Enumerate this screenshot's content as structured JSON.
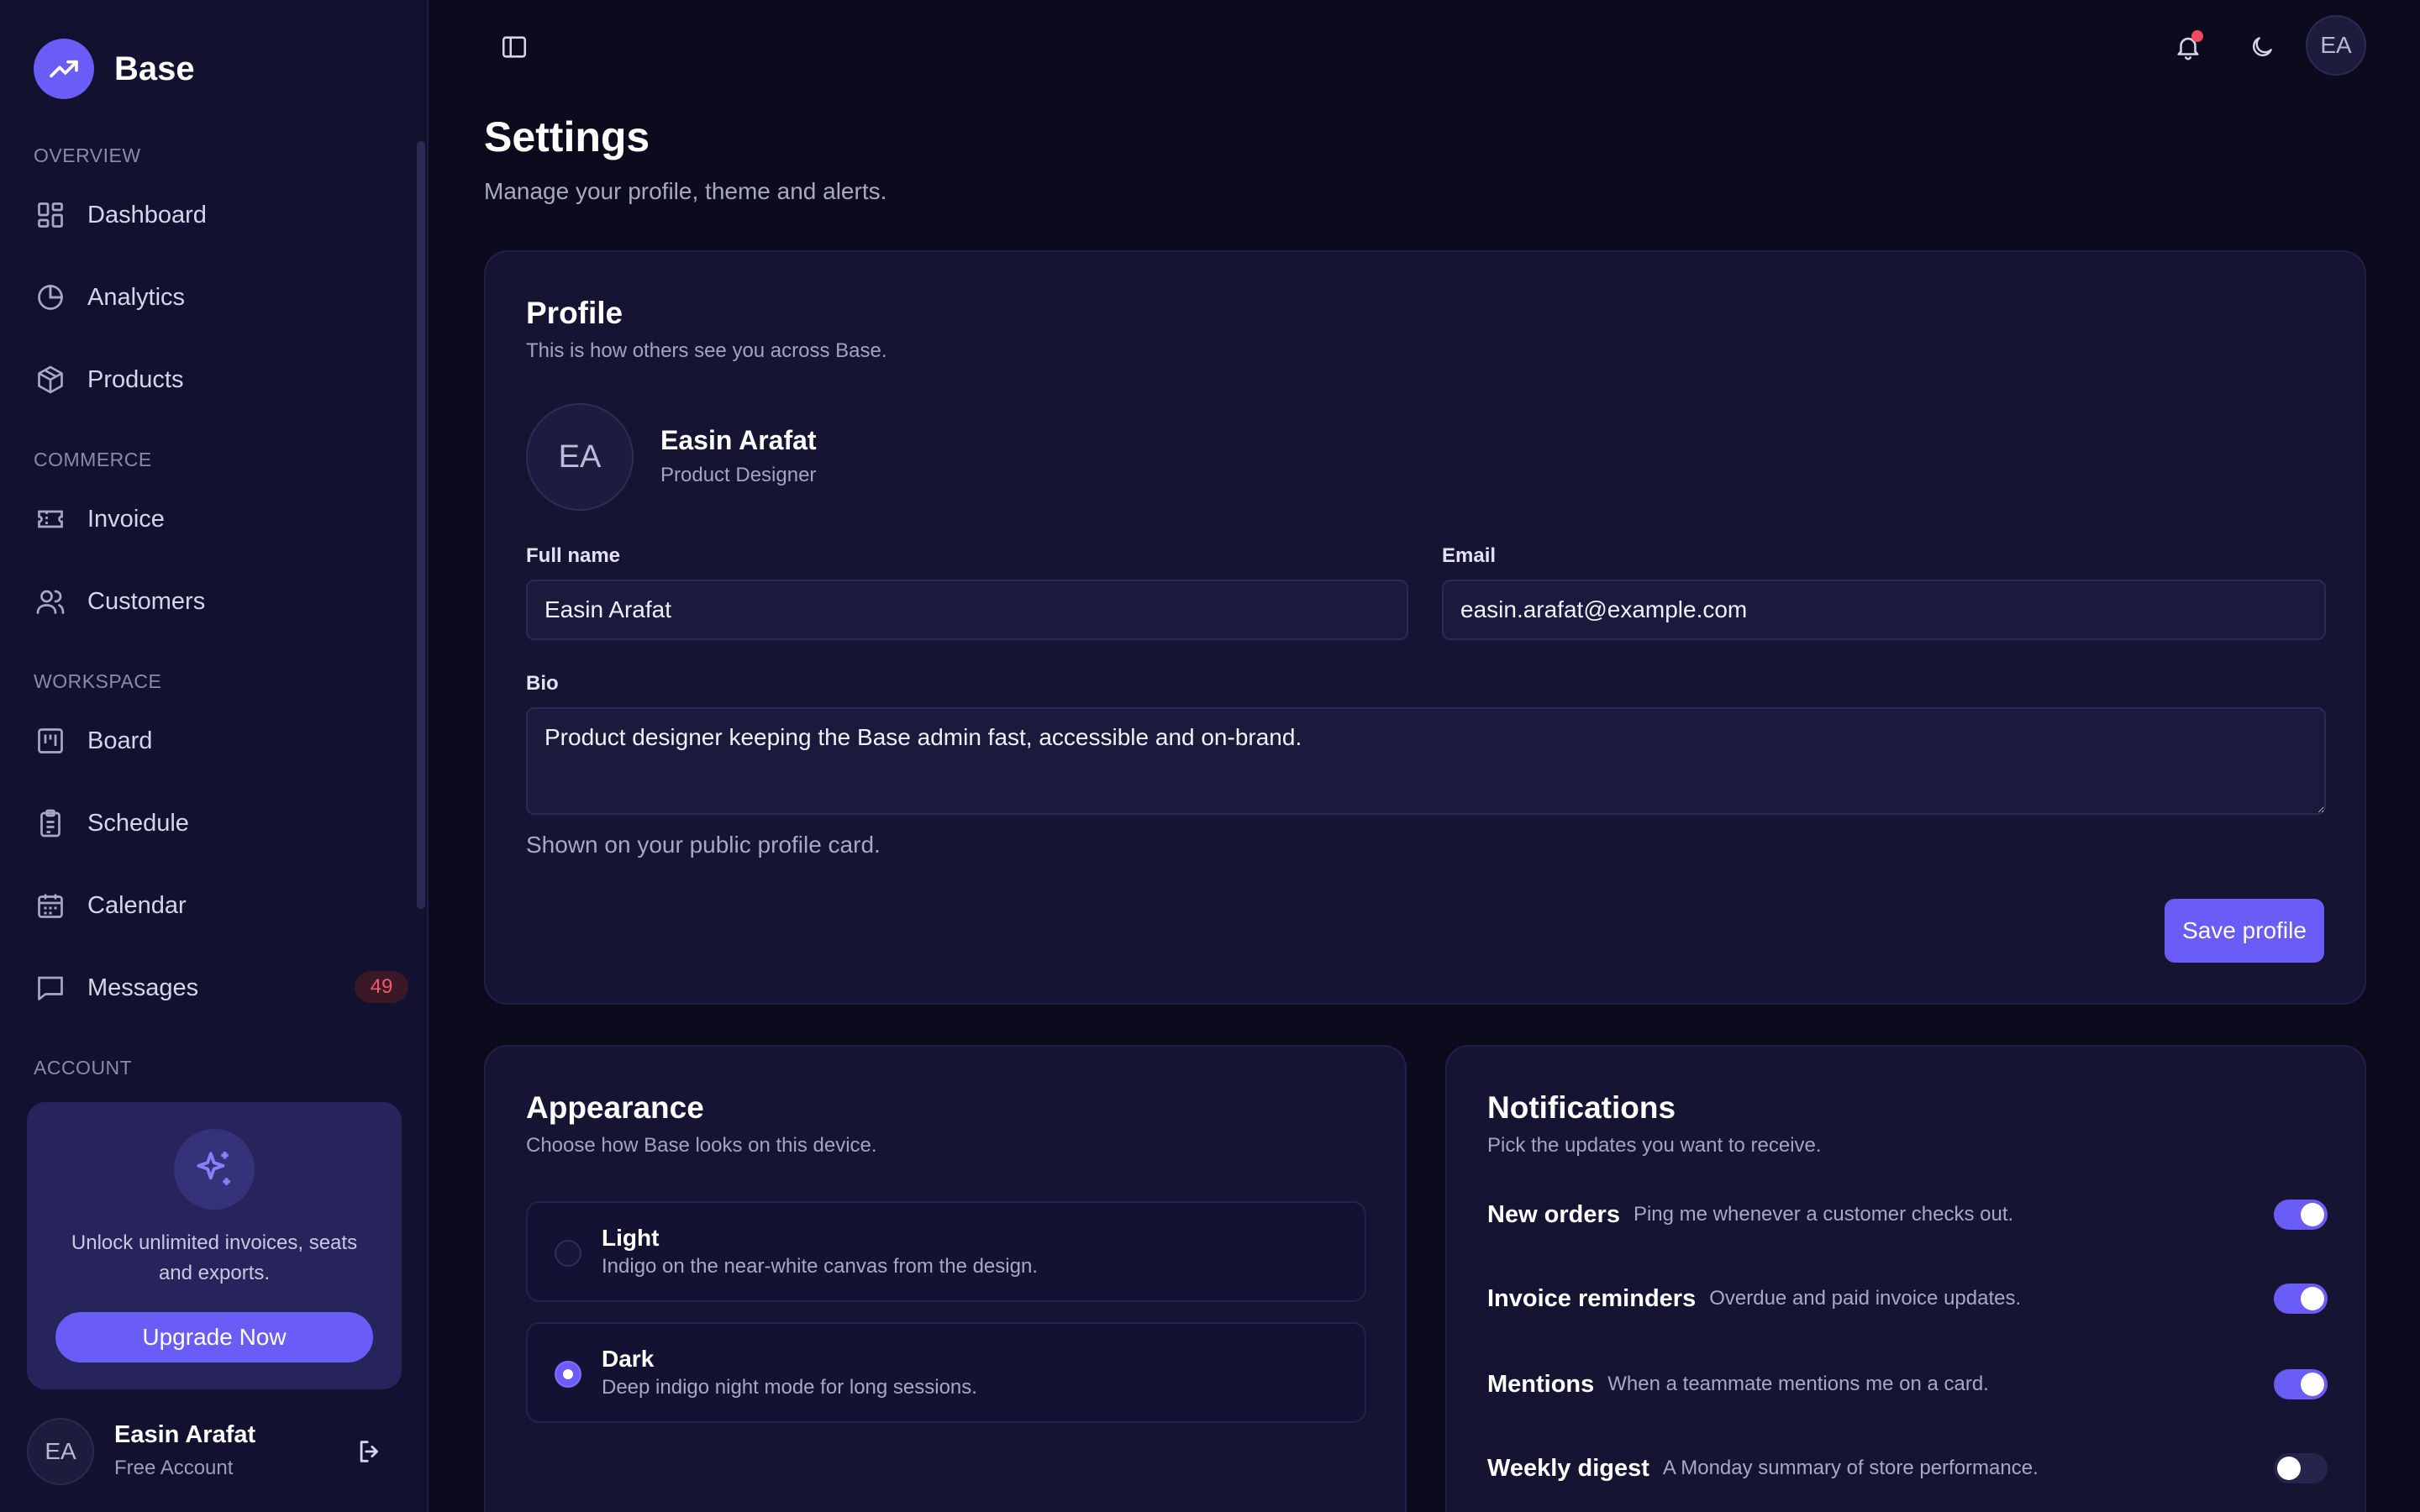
{
  "app": {
    "name": "Base"
  },
  "sidebar": {
    "sections": {
      "overview": "OVERVIEW",
      "commerce": "COMMERCE",
      "workspace": "WORKSPACE",
      "account": "ACCOUNT"
    },
    "items": [
      {
        "label": "Dashboard",
        "icon": "dashboard-icon"
      },
      {
        "label": "Analytics",
        "icon": "pie-chart-icon"
      },
      {
        "label": "Products",
        "icon": "box-icon"
      },
      {
        "label": "Invoice",
        "icon": "ticket-icon"
      },
      {
        "label": "Customers",
        "icon": "users-icon"
      },
      {
        "label": "Board",
        "icon": "kanban-icon"
      },
      {
        "label": "Schedule",
        "icon": "clipboard-icon"
      },
      {
        "label": "Calendar",
        "icon": "calendar-icon"
      },
      {
        "label": "Messages",
        "icon": "message-icon",
        "badge": "49"
      }
    ],
    "promo": {
      "text": "Unlock unlimited invoices, seats and exports.",
      "button": "Upgrade Now"
    },
    "user": {
      "initials": "EA",
      "name": "Easin Arafat",
      "plan": "Free Account"
    }
  },
  "topbar": {
    "avatar_initials": "EA"
  },
  "page": {
    "title": "Settings",
    "subtitle": "Manage your profile, theme and alerts."
  },
  "profile": {
    "title": "Profile",
    "subtitle": "This is how others see you across Base.",
    "initials": "EA",
    "name": "Easin Arafat",
    "role": "Product Designer",
    "full_name_label": "Full name",
    "full_name_value": "Easin Arafat",
    "email_label": "Email",
    "email_value": "easin.arafat@example.com",
    "bio_label": "Bio",
    "bio_value": "Product designer keeping the Base admin fast, accessible and on-brand.",
    "bio_hint": "Shown on your public profile card.",
    "save_label": "Save profile"
  },
  "appearance": {
    "title": "Appearance",
    "subtitle": "Choose how Base looks on this device.",
    "options": [
      {
        "title": "Light",
        "desc": "Indigo on the near-white canvas from the design.",
        "selected": false
      },
      {
        "title": "Dark",
        "desc": "Deep indigo night mode for long sessions.",
        "selected": true
      }
    ]
  },
  "notifications": {
    "title": "Notifications",
    "subtitle": "Pick the updates you want to receive.",
    "items": [
      {
        "title": "New orders",
        "desc": "Ping me whenever a customer checks out.",
        "enabled": true
      },
      {
        "title": "Invoice reminders",
        "desc": "Overdue and paid invoice updates.",
        "enabled": true
      },
      {
        "title": "Mentions",
        "desc": "When a teammate mentions me on a card.",
        "enabled": true
      },
      {
        "title": "Weekly digest",
        "desc": "A Monday summary of store performance.",
        "enabled": false
      }
    ]
  },
  "colors": {
    "accent": "#6a5cf6",
    "background": "#0c0b1d",
    "sidebar": "#121130",
    "card": "#151433",
    "badge_text": "#f05a6e",
    "notification_dot": "#f24a5e"
  }
}
